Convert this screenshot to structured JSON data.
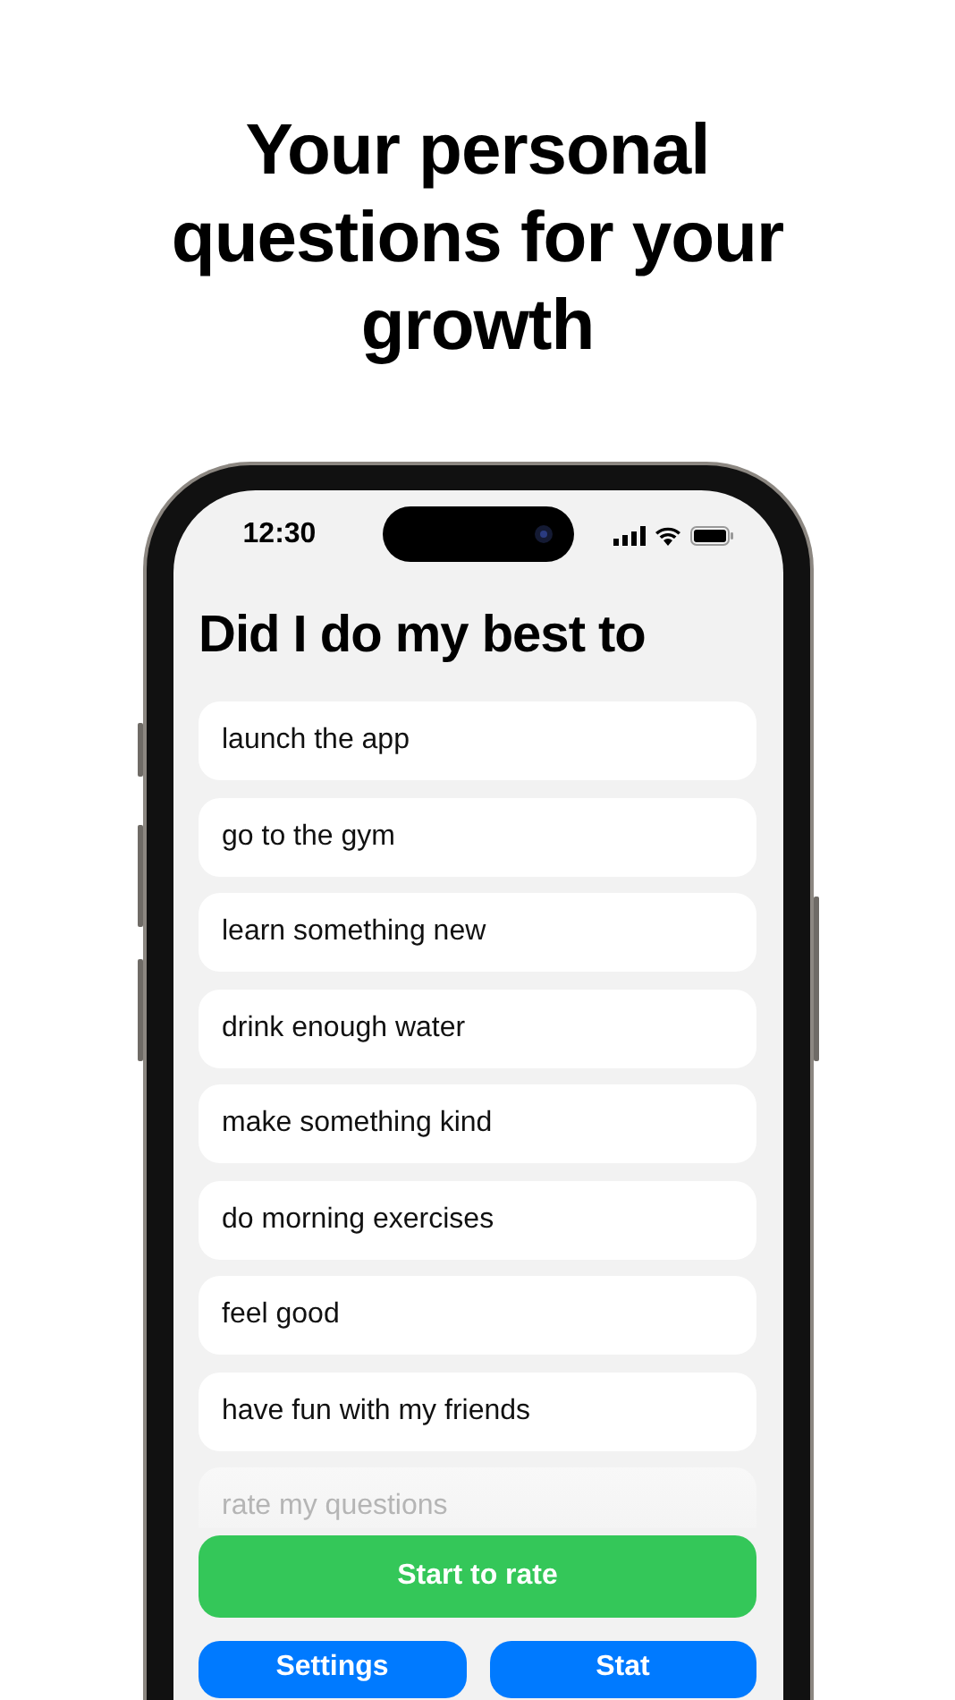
{
  "headline": "Your personal questions for your growth",
  "status_bar": {
    "time": "12:30"
  },
  "title": "Did I do my best to",
  "questions": [
    {
      "text": "launch the app",
      "faded": false
    },
    {
      "text": "go to the gym",
      "faded": false
    },
    {
      "text": "learn something new",
      "faded": false
    },
    {
      "text": "drink enough water",
      "faded": false
    },
    {
      "text": "make something kind",
      "faded": false
    },
    {
      "text": "do morning exercises",
      "faded": false
    },
    {
      "text": "feel good",
      "faded": false
    },
    {
      "text": "have fun with my friends",
      "faded": false
    },
    {
      "text": "rate my questions",
      "faded": true
    }
  ],
  "buttons": [
    {
      "label": "Start to rate",
      "kind": "primary"
    },
    {
      "label": "Settings",
      "kind": "secondary"
    },
    {
      "label": "Stat",
      "kind": "secondary"
    }
  ]
}
